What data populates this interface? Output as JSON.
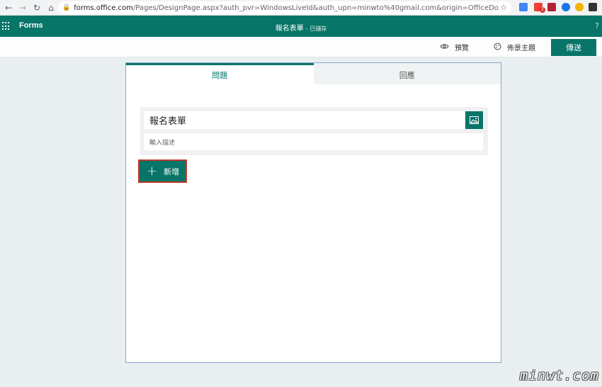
{
  "browser": {
    "url_host": "forms.office.com",
    "url_path": "/Pages/DesignPage.aspx?auth_pvr=WindowsLiveId&auth_upn=minwto%40gmail.com&origin=OfficeDotCom&lang=zh-TW&Action...",
    "extension_badge": "2"
  },
  "app": {
    "name": "Forms",
    "doc_title": "報名表單",
    "saved_status": "- 已儲存",
    "help": "?"
  },
  "commands": {
    "preview": "預覽",
    "theme": "佈景主題",
    "send": "傳送"
  },
  "tabs": [
    {
      "label": "問題",
      "active": true
    },
    {
      "label": "回應",
      "active": false
    }
  ],
  "form": {
    "title": "報名表單",
    "description_placeholder": "輸入描述",
    "add_button": "新增"
  },
  "colors": {
    "brand": "#077568",
    "highlight_border": "#c0392b"
  },
  "watermark": "minwt.com"
}
